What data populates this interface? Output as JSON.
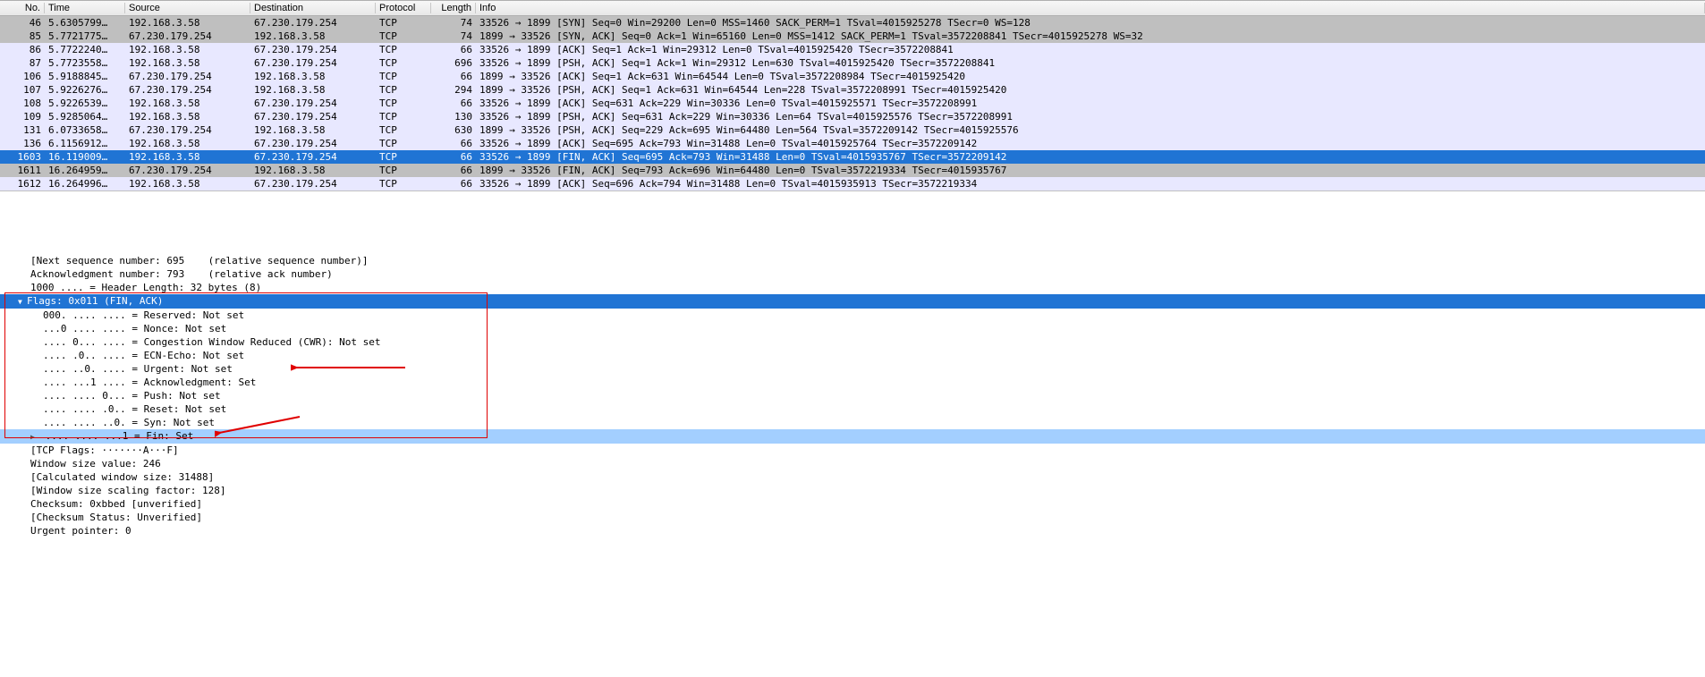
{
  "headers": {
    "no": "No.",
    "time": "Time",
    "source": "Source",
    "destination": "Destination",
    "protocol": "Protocol",
    "length": "Length",
    "info": "Info"
  },
  "packets": [
    {
      "no": "46",
      "time": "5.6305799…",
      "src": "192.168.3.58",
      "dst": "67.230.179.254",
      "proto": "TCP",
      "len": "74",
      "info": "33526 → 1899 [SYN] Seq=0 Win=29200 Len=0 MSS=1460 SACK_PERM=1 TSval=4015925278 TSecr=0 WS=128",
      "bg": "gray"
    },
    {
      "no": "85",
      "time": "5.7721775…",
      "src": "67.230.179.254",
      "dst": "192.168.3.58",
      "proto": "TCP",
      "len": "74",
      "info": "1899 → 33526 [SYN, ACK] Seq=0 Ack=1 Win=65160 Len=0 MSS=1412 SACK_PERM=1 TSval=3572208841 TSecr=4015925278 WS=32",
      "bg": "gray"
    },
    {
      "no": "86",
      "time": "5.7722240…",
      "src": "192.168.3.58",
      "dst": "67.230.179.254",
      "proto": "TCP",
      "len": "66",
      "info": "33526 → 1899 [ACK] Seq=1 Ack=1 Win=29312 Len=0 TSval=4015925420 TSecr=3572208841",
      "bg": "lav"
    },
    {
      "no": "87",
      "time": "5.7723558…",
      "src": "192.168.3.58",
      "dst": "67.230.179.254",
      "proto": "TCP",
      "len": "696",
      "info": "33526 → 1899 [PSH, ACK] Seq=1 Ack=1 Win=29312 Len=630 TSval=4015925420 TSecr=3572208841",
      "bg": "lav"
    },
    {
      "no": "106",
      "time": "5.9188845…",
      "src": "67.230.179.254",
      "dst": "192.168.3.58",
      "proto": "TCP",
      "len": "66",
      "info": "1899 → 33526 [ACK] Seq=1 Ack=631 Win=64544 Len=0 TSval=3572208984 TSecr=4015925420",
      "bg": "lav"
    },
    {
      "no": "107",
      "time": "5.9226276…",
      "src": "67.230.179.254",
      "dst": "192.168.3.58",
      "proto": "TCP",
      "len": "294",
      "info": "1899 → 33526 [PSH, ACK] Seq=1 Ack=631 Win=64544 Len=228 TSval=3572208991 TSecr=4015925420",
      "bg": "lav"
    },
    {
      "no": "108",
      "time": "5.9226539…",
      "src": "192.168.3.58",
      "dst": "67.230.179.254",
      "proto": "TCP",
      "len": "66",
      "info": "33526 → 1899 [ACK] Seq=631 Ack=229 Win=30336 Len=0 TSval=4015925571 TSecr=3572208991",
      "bg": "lav"
    },
    {
      "no": "109",
      "time": "5.9285064…",
      "src": "192.168.3.58",
      "dst": "67.230.179.254",
      "proto": "TCP",
      "len": "130",
      "info": "33526 → 1899 [PSH, ACK] Seq=631 Ack=229 Win=30336 Len=64 TSval=4015925576 TSecr=3572208991",
      "bg": "lav"
    },
    {
      "no": "131",
      "time": "6.0733658…",
      "src": "67.230.179.254",
      "dst": "192.168.3.58",
      "proto": "TCP",
      "len": "630",
      "info": "1899 → 33526 [PSH, ACK] Seq=229 Ack=695 Win=64480 Len=564 TSval=3572209142 TSecr=4015925576",
      "bg": "lav"
    },
    {
      "no": "136",
      "time": "6.1156912…",
      "src": "192.168.3.58",
      "dst": "67.230.179.254",
      "proto": "TCP",
      "len": "66",
      "info": "33526 → 1899 [ACK] Seq=695 Ack=793 Win=31488 Len=0 TSval=4015925764 TSecr=3572209142",
      "bg": "lav"
    },
    {
      "no": "1603",
      "time": "16.119009…",
      "src": "192.168.3.58",
      "dst": "67.230.179.254",
      "proto": "TCP",
      "len": "66",
      "info": "33526 → 1899 [FIN, ACK] Seq=695 Ack=793 Win=31488 Len=0 TSval=4015935767 TSecr=3572209142",
      "bg": "sel"
    },
    {
      "no": "1611",
      "time": "16.264959…",
      "src": "67.230.179.254",
      "dst": "192.168.3.58",
      "proto": "TCP",
      "len": "66",
      "info": "1899 → 33526 [FIN, ACK] Seq=793 Ack=696 Win=64480 Len=0 TSval=3572219334 TSecr=4015935767",
      "bg": "gray"
    },
    {
      "no": "1612",
      "time": "16.264996…",
      "src": "192.168.3.58",
      "dst": "67.230.179.254",
      "proto": "TCP",
      "len": "66",
      "info": "33526 → 1899 [ACK] Seq=696 Ack=794 Win=31488 Len=0 TSval=4015935913 TSecr=3572219334",
      "bg": "lav"
    }
  ],
  "details": {
    "nextseq": "[Next sequence number: 695    (relative sequence number)]",
    "acknum": "Acknowledgment number: 793    (relative ack number)",
    "hdrlen": "1000 .... = Header Length: 32 bytes (8)",
    "flagsheader": "Flags: 0x011 (FIN, ACK)",
    "flags": [
      "000. .... .... = Reserved: Not set",
      "...0 .... .... = Nonce: Not set",
      ".... 0... .... = Congestion Window Reduced (CWR): Not set",
      ".... .0.. .... = ECN-Echo: Not set",
      ".... ..0. .... = Urgent: Not set",
      ".... ...1 .... = Acknowledgment: Set",
      ".... .... 0... = Push: Not set",
      ".... .... .0.. = Reset: Not set",
      ".... .... ..0. = Syn: Not set"
    ],
    "finline": ".... .... ...1 = Fin: Set",
    "after": [
      "[TCP Flags: ·······A···F]",
      "Window size value: 246",
      "[Calculated window size: 31488]",
      "[Window size scaling factor: 128]",
      "Checksum: 0xbbed [unverified]",
      "[Checksum Status: Unverified]",
      "Urgent pointer: 0"
    ]
  }
}
